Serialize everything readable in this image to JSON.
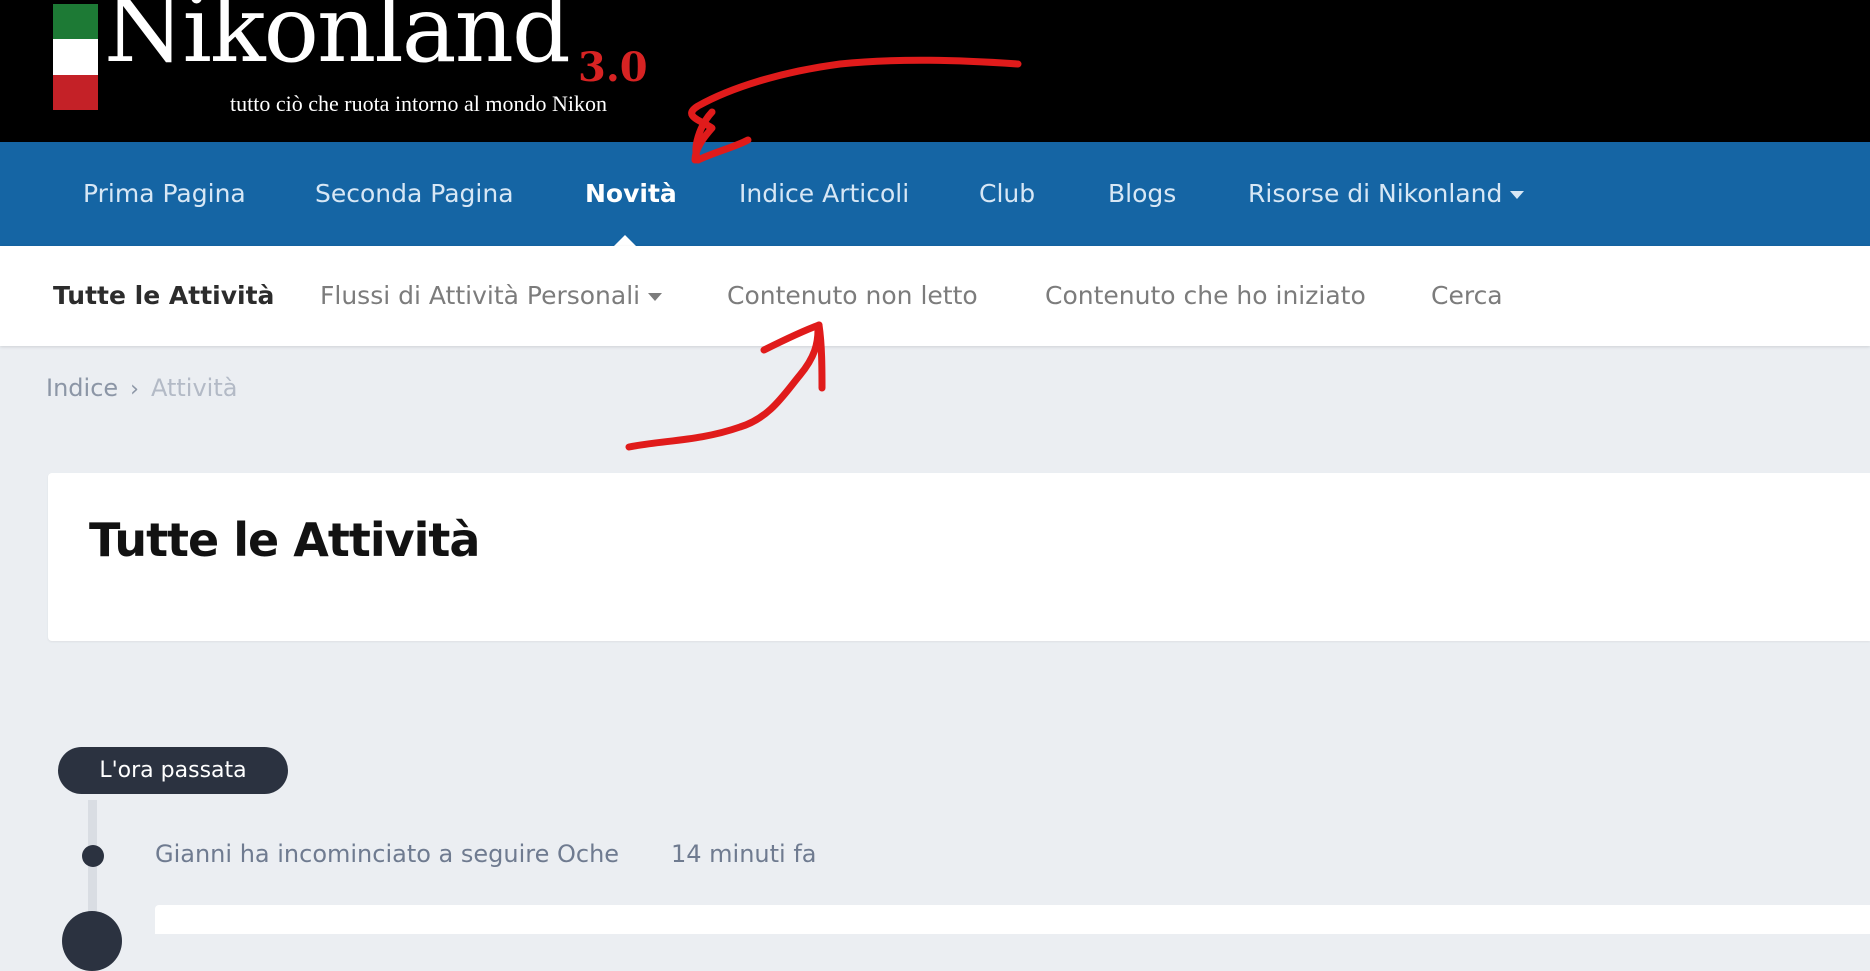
{
  "brand": {
    "name": "Nikonland",
    "version": "3.0",
    "tagline": "tutto ciò che ruota intorno al mondo Nikon",
    "colors": {
      "flag_green": "#1d7a35",
      "flag_white": "#ffffff",
      "flag_red": "#c42127",
      "version_red": "#d72323"
    }
  },
  "primary_nav": {
    "items": [
      {
        "label": "Prima Pagina"
      },
      {
        "label": "Seconda Pagina"
      },
      {
        "label": "Novità",
        "active": true
      },
      {
        "label": "Indice Articoli"
      },
      {
        "label": "Club"
      },
      {
        "label": "Blogs"
      },
      {
        "label": "Risorse di Nikonland",
        "has_dropdown": true,
        "icon": "caret-down-icon"
      }
    ],
    "background": "#1565a4"
  },
  "secondary_nav": {
    "items": [
      {
        "label": "Tutte le Attività",
        "active": true
      },
      {
        "label": "Flussi di Attività Personali",
        "has_dropdown": true,
        "icon": "caret-down-icon"
      },
      {
        "label": "Contenuto non letto"
      },
      {
        "label": "Contenuto che ho iniziato"
      },
      {
        "label": "Cerca"
      }
    ]
  },
  "breadcrumb": {
    "items": [
      {
        "label": "Indice"
      },
      {
        "label": "Attività"
      }
    ],
    "separator_icon": "chevron-right-icon"
  },
  "page": {
    "title": "Tutte le Attività"
  },
  "timeline": {
    "section_label": "L'ora passata",
    "entries": [
      {
        "text": "Gianni ha incominciato a seguire Oche",
        "time": "14 minuti fa"
      }
    ]
  },
  "annotations": {
    "color": "#e01b1b",
    "icons": [
      "red-arrow-to-novita-icon",
      "red-arrow-to-unread-icon"
    ]
  }
}
